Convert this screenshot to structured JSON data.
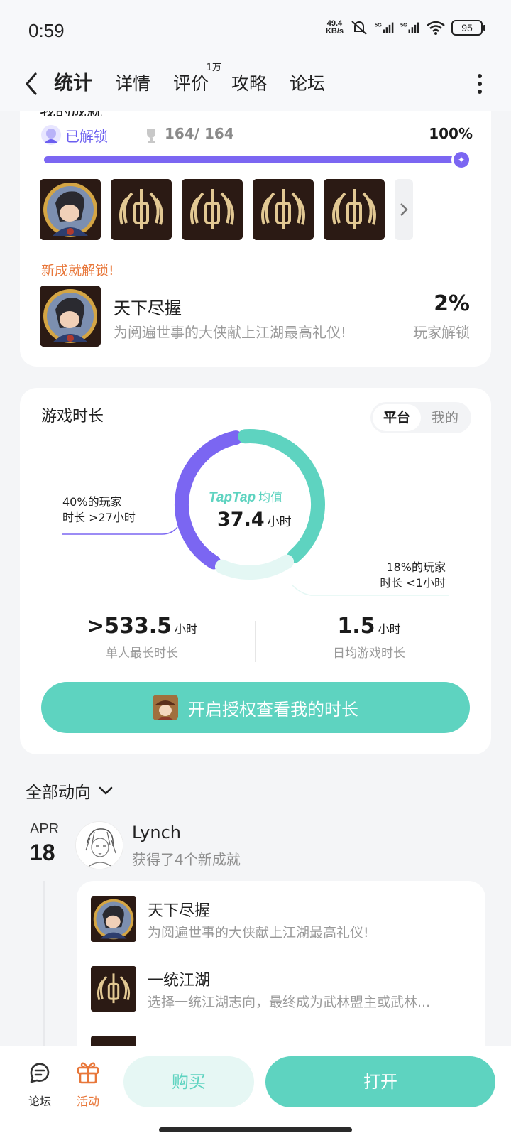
{
  "status_bar": {
    "time": "0:59",
    "net_speed_value": "49.4",
    "net_speed_unit": "KB/s",
    "signal1": "5G",
    "signal2": "5G",
    "battery": "95"
  },
  "nav": {
    "tabs": [
      {
        "label": "统计",
        "active": true
      },
      {
        "label": "详情"
      },
      {
        "label": "评价",
        "sup": "1万"
      },
      {
        "label": "攻略"
      },
      {
        "label": "论坛"
      }
    ]
  },
  "achievements": {
    "cut_title": "我的成就",
    "unlocked_label": "已解锁",
    "count": "164/ 164",
    "percent": "100%",
    "progress_fraction": 1.0,
    "new_label": "新成就解锁!",
    "new_item": {
      "name": "天下尽握",
      "desc": "为阅遍世事的大侠献上江湖最高礼仪!",
      "rate": "2%",
      "rate_label": "玩家解锁"
    }
  },
  "playtime": {
    "title": "游戏时长",
    "toggle": [
      "平台",
      "我的"
    ],
    "brand": "TapTap",
    "brand_sub": "均值",
    "avg_value": "37.4",
    "avg_unit": "小时",
    "left_note_line1": "40%的玩家",
    "left_note_line2": "时长 >27小时",
    "right_note_line1": "18%的玩家",
    "right_note_line2": "时长 <1小时",
    "segments": [
      {
        "name": "time-gt-27h",
        "percent": 40,
        "color": "#7b66f2"
      },
      {
        "name": "middle",
        "percent": 42,
        "color": "#5ed3c0"
      },
      {
        "name": "time-lt-1h",
        "percent": 18,
        "color": "#e4f7f4"
      }
    ],
    "stat_max_value": ">533.5",
    "stat_max_unit": "小时",
    "stat_max_label": "单人最长时长",
    "stat_avg_value": "1.5",
    "stat_avg_unit": "小时",
    "stat_avg_label": "日均游戏时长",
    "auth_button": "开启授权查看我的时长"
  },
  "feed": {
    "filter": "全部动向",
    "date_month": "APR",
    "date_day": "18",
    "user": "Lynch",
    "action": "获得了4个新成就",
    "items": [
      {
        "name": "天下尽握",
        "desc": "为阅遍世事的大侠献上江湖最高礼仪!"
      },
      {
        "name": "一统江湖",
        "desc": "选择一统江湖志向，最终成为武林盟主或武林..."
      }
    ]
  },
  "bottom": {
    "forum": "论坛",
    "activity": "活动",
    "buy": "购买",
    "open": "打开"
  },
  "colors": {
    "accent": "#5ed3c0",
    "purple": "#7b66f2",
    "orange": "#e8773a"
  }
}
